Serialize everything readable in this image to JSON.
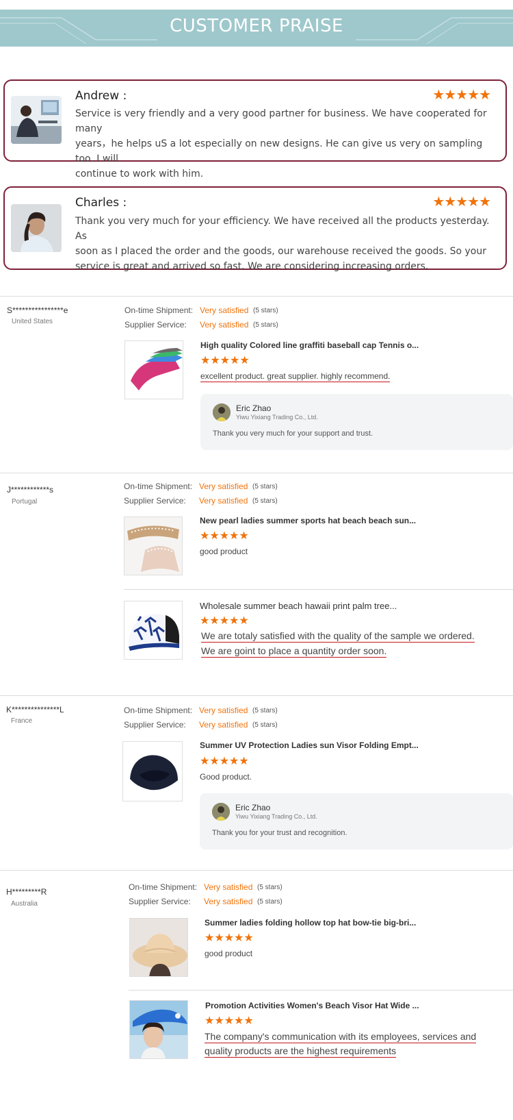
{
  "banner": {
    "title": "CUSTOMER PRAISE"
  },
  "praise": [
    {
      "name": "Andrew :",
      "stars": "★★★★★",
      "lines": [
        "Service is very friendly and a very good partner for business. We have cooperated for many",
        "years，he helps uS a lot especially on new designs. He can give us very  on sampling too. I will",
        "continue to work with him."
      ]
    },
    {
      "name": "Charles :",
      "stars": "★★★★★",
      "lines": [
        "Thank you very much for your efficiency. We have received all the products  yesterday. As",
        "soon as I placed the order and the goods, our warehouse received the goods. So  your",
        "service is great and arrived so fast. We are considering increasing orders."
      ]
    }
  ],
  "labels": {
    "ontime": "On-time Shipment:",
    "supplier": "Supplier Service:",
    "very_satisfied": "Very satisfied",
    "five_stars": "(5 stars)",
    "stars": "★★★★★"
  },
  "reviews": [
    {
      "name": "S****************e",
      "country": "United States",
      "products": [
        {
          "title": "High quality Colored line graffiti baseball cap Tennis o...",
          "review": "excellent product. great supplier. highly recommend."
        }
      ],
      "reply": {
        "name": "Eric Zhao",
        "company": "Yiwu Yixiang Trading Co., Ltd.",
        "text": "Thank you very much for your support and trust."
      }
    },
    {
      "name": "J************s",
      "country": "Portugal",
      "products": [
        {
          "title": "New pearl ladies summer sports hat beach beach sun...",
          "review": "good product"
        },
        {
          "title": "Wholesale summer beach hawaii print palm tree...",
          "review_line1": "We are totaly satisfied with the quality of the sample we ordered.",
          "review_line2": "We are goint to place a quantity order soon."
        }
      ]
    },
    {
      "name": "K***************L",
      "country": "France",
      "products": [
        {
          "title": "Summer UV Protection Ladies sun Visor Folding Empt...",
          "review": "Good product."
        }
      ],
      "reply": {
        "name": "Eric Zhao",
        "company": "Yiwu Yixiang Trading Co., Ltd.",
        "text": "Thank you for your trust and recognition."
      }
    },
    {
      "name": "H*********R",
      "country": "Australia",
      "products": [
        {
          "title": "Summer ladies folding hollow top hat bow-tie big-bri...",
          "review": "good product"
        },
        {
          "title": "Promotion Activities Women's Beach Visor Hat Wide ...",
          "review_line1": "The company's communication with its employees, services and",
          "review_line2": "quality products are the highest requirements"
        }
      ]
    }
  ]
}
